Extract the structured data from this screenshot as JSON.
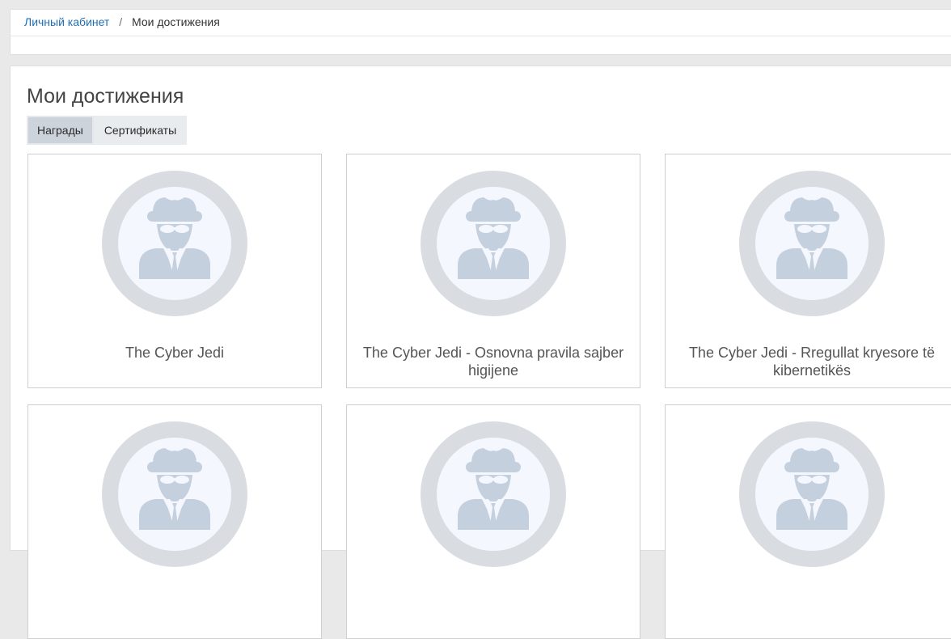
{
  "breadcrumb": {
    "home_label": "Личный кабинет",
    "separator": "/",
    "current_label": "Мои достижения"
  },
  "page": {
    "title": "Мои достижения"
  },
  "tabs": [
    {
      "label": "Награды",
      "active": true
    },
    {
      "label": "Сертификаты",
      "active": false
    }
  ],
  "badges": [
    {
      "title": "The Cyber Jedi",
      "icon": "spy-badge-icon"
    },
    {
      "title": "The Cyber Jedi - Osnovna pravila sajber higijene",
      "icon": "spy-badge-icon"
    },
    {
      "title": "The Cyber Jedi - Rregullat kryesore të kibernetikës",
      "icon": "spy-badge-icon"
    },
    {
      "title": "",
      "icon": "spy-badge-icon"
    },
    {
      "title": "",
      "icon": "spy-badge-icon"
    },
    {
      "title": "",
      "icon": "spy-badge-icon"
    }
  ],
  "colors": {
    "link": "#1f6fb5",
    "badge_ring": "#d9dce1",
    "badge_inner": "#f4f7fd",
    "badge_figure": "#c5d0df",
    "active_tab": "#cdd3da",
    "tab": "#e9ecef"
  }
}
